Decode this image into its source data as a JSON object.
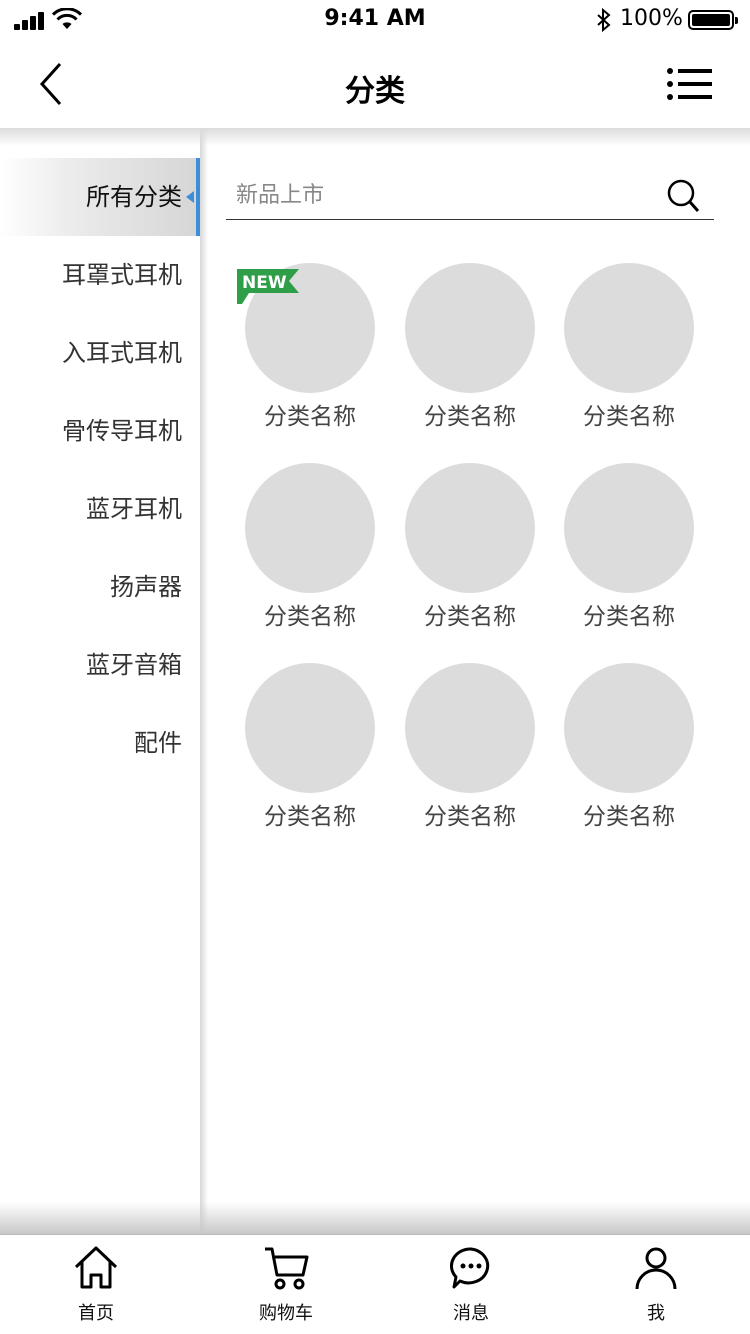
{
  "status_bar": {
    "time": "9:41 AM",
    "battery": "100%"
  },
  "nav": {
    "title": "分类"
  },
  "sidebar": {
    "items": [
      {
        "label": "所有分类",
        "active": true
      },
      {
        "label": "耳罩式耳机"
      },
      {
        "label": "入耳式耳机"
      },
      {
        "label": "骨传导耳机"
      },
      {
        "label": "蓝牙耳机"
      },
      {
        "label": "扬声器"
      },
      {
        "label": "蓝牙音箱"
      },
      {
        "label": "配件"
      }
    ]
  },
  "search": {
    "placeholder": "新品上市"
  },
  "categories": {
    "badge": "NEW",
    "items": [
      {
        "label": "分类名称"
      },
      {
        "label": "分类名称"
      },
      {
        "label": "分类名称"
      },
      {
        "label": "分类名称"
      },
      {
        "label": "分类名称"
      },
      {
        "label": "分类名称"
      },
      {
        "label": "分类名称"
      },
      {
        "label": "分类名称"
      },
      {
        "label": "分类名称"
      }
    ]
  },
  "tab_bar": {
    "tabs": [
      {
        "label": "首页",
        "icon": "home-icon"
      },
      {
        "label": "购物车",
        "icon": "cart-icon"
      },
      {
        "label": "消息",
        "icon": "message-icon"
      },
      {
        "label": "我",
        "icon": "user-icon"
      }
    ]
  },
  "colors": {
    "accent": "#3b8fd8",
    "badge": "#2e9e48",
    "placeholder_circle": "#dcdcdc"
  }
}
